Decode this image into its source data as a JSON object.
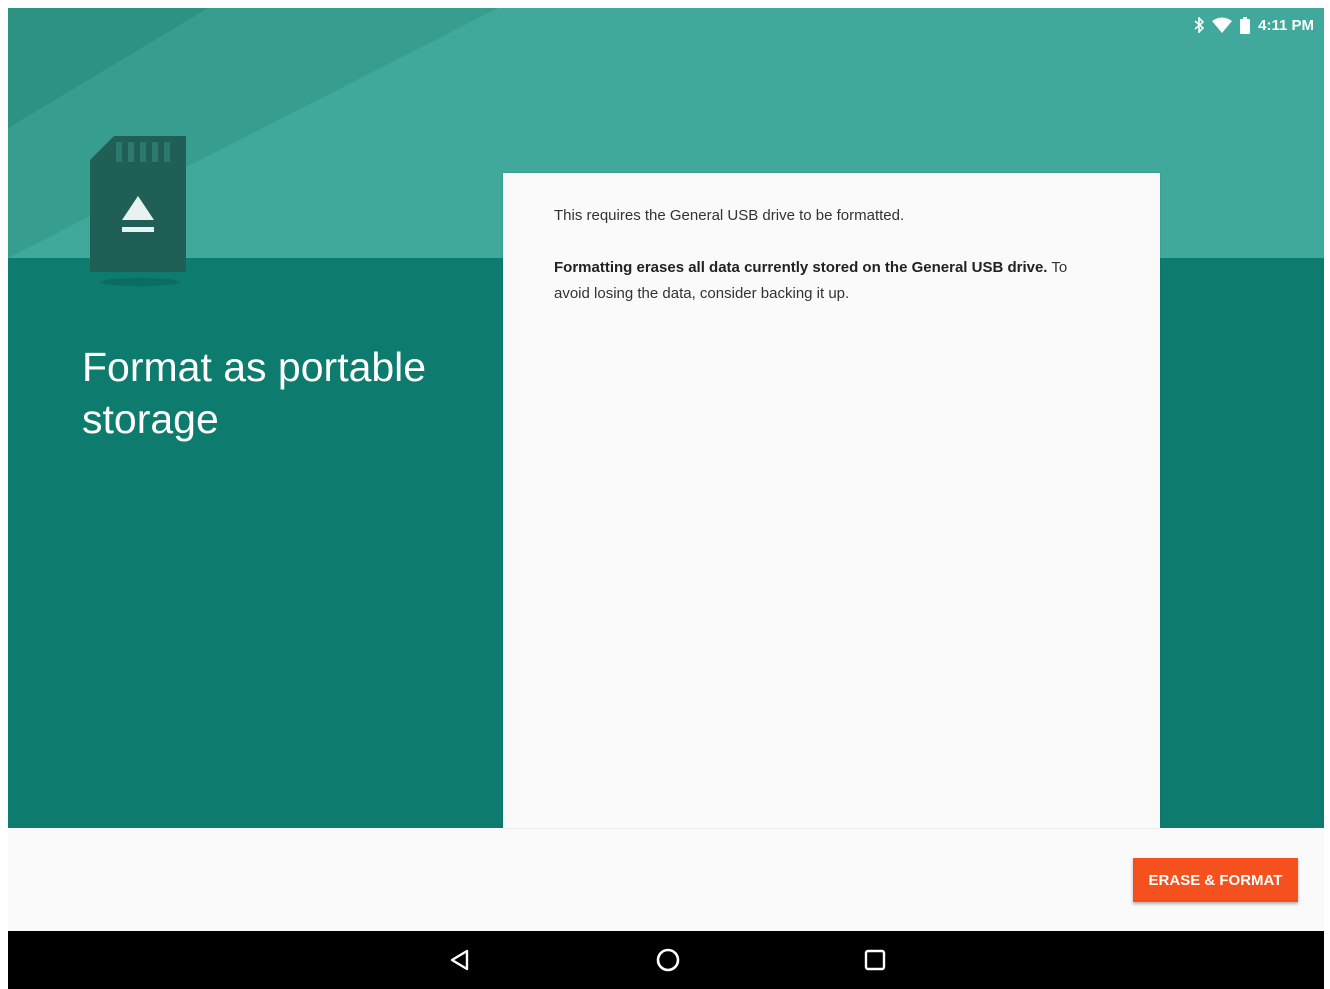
{
  "status_bar": {
    "time": "4:11 PM",
    "icons": [
      "bluetooth-icon",
      "wifi-icon",
      "battery-icon"
    ]
  },
  "wizard": {
    "title": "Format as portable storage",
    "icon": "sd-card-eject-icon",
    "message_1": "This requires the General USB drive to be formatted.",
    "message_2_bold": "Formatting erases all data currently stored on the General USB drive.",
    "message_2_rest": " To avoid losing the data, consider backing it up.",
    "primary_button": "ERASE & FORMAT"
  },
  "nav_bar": {
    "buttons": [
      "back-icon",
      "home-icon",
      "recents-icon"
    ]
  },
  "colors": {
    "header": "#40a99c",
    "body_teal": "#0d7b6e",
    "accent_button": "#f4511e"
  }
}
